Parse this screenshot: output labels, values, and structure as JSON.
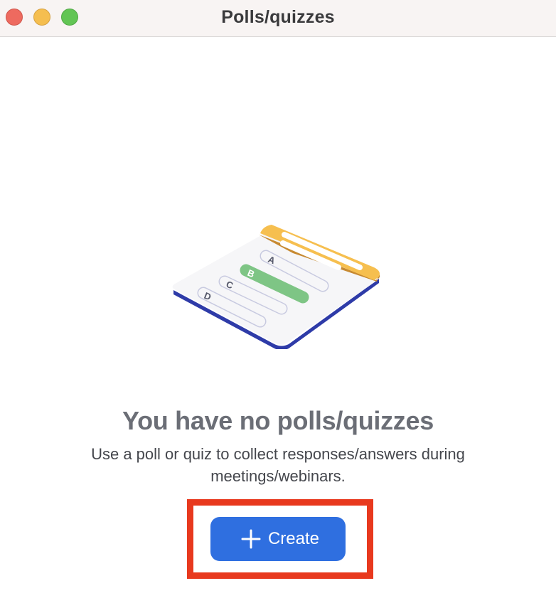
{
  "window": {
    "title": "Polls/quizzes"
  },
  "illustration": {
    "icon": "poll-quiz-card-illustration",
    "options": [
      "A",
      "B",
      "C",
      "D"
    ],
    "colors": {
      "header": "#f6bf4f",
      "selected_option": "#7ec585",
      "card_edge": "#2e3ba8"
    }
  },
  "empty_state": {
    "title": "You have no polls/quizzes",
    "description": "Use a poll or quiz to collect responses/answers during meetings/webinars."
  },
  "actions": {
    "create_label": "Create",
    "create_icon": "plus-icon",
    "accent_color": "#2f6fe0",
    "highlight_color": "#e8391e"
  }
}
